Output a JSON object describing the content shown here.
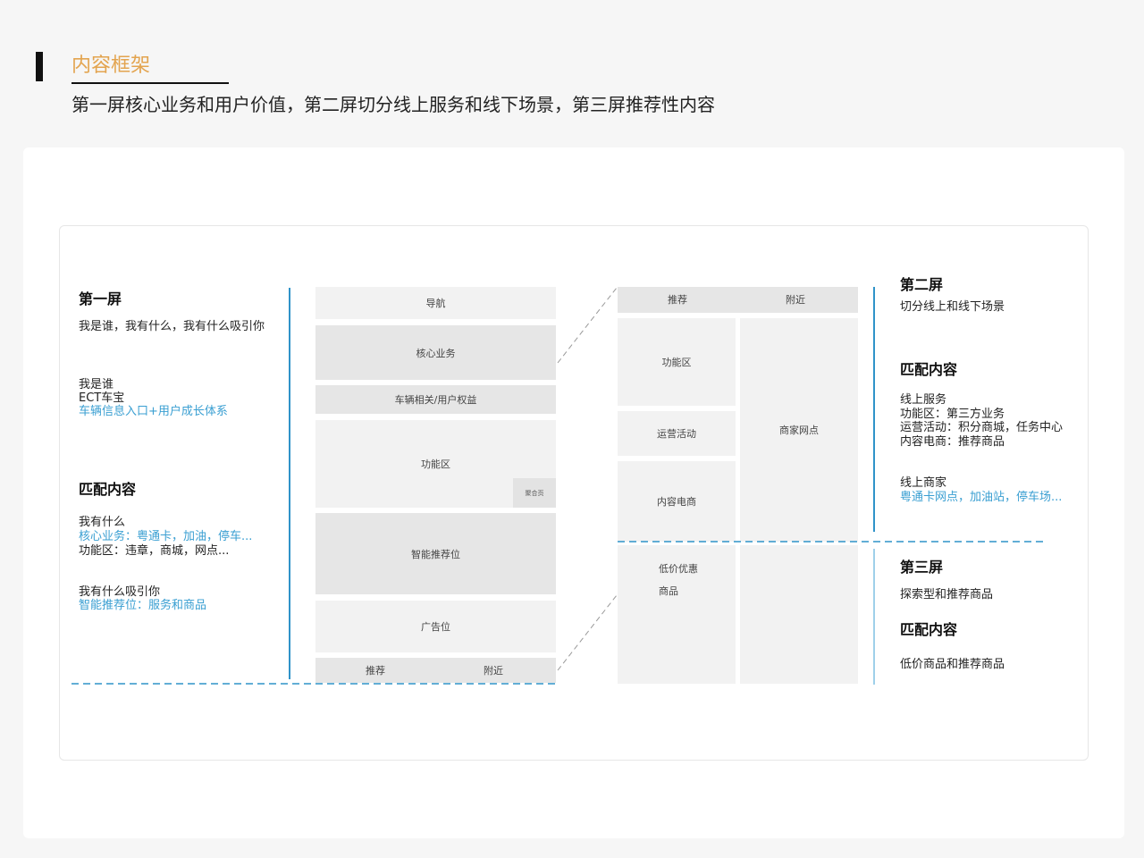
{
  "header": {
    "title": "内容框架",
    "subtitle": "第一屏核心业务和用户价值，第二屏切分线上服务和线下场景，第三屏推荐性内容"
  },
  "left_panel": {
    "screen_title": "第一屏",
    "screen_desc": "我是谁，我有什么，我有什么吸引你",
    "who_label": "我是谁",
    "who_name": "ECT车宝",
    "who_detail": "车辆信息入口+用户成长体系",
    "match_title": "匹配内容",
    "what_label": "我有什么",
    "what_core": "核心业务：粤通卡，加油，停车...",
    "what_func": "功能区：违章，商城，网点...",
    "attract_label": "我有什么吸引你",
    "attract_detail": "智能推荐位：服务和商品"
  },
  "wireframe_screen1": {
    "nav": "导航",
    "core": "核心业务",
    "vehicle": "车辆相关/用户权益",
    "function": "功能区",
    "aggregate": "聚合页",
    "smart": "智能推荐位",
    "ad": "广告位",
    "tab_recommend": "推荐",
    "tab_nearby": "附近"
  },
  "wireframe_screen2": {
    "tab_recommend": "推荐",
    "tab_nearby": "附近",
    "function": "功能区",
    "operation": "运营活动",
    "ecommerce": "内容电商",
    "merchant": "商家网点",
    "discount": "低价优惠",
    "goods": "商品"
  },
  "right_panel": {
    "screen2_title": "第二屏",
    "screen2_desc": "切分线上和线下场景",
    "match_title": "匹配内容",
    "online_service": "线上服务",
    "func_area": "功能区：第三方业务",
    "operation": "运营活动：积分商城，任务中心",
    "ecommerce": "内容电商：推荐商品",
    "online_merchant": "线上商家",
    "merchant_detail": "粤通卡网点，加油站，停车场...",
    "screen3_title": "第三屏",
    "screen3_desc": "探索型和推荐商品",
    "match_title2": "匹配内容",
    "screen3_detail": "低价商品和推荐商品"
  },
  "colors": {
    "accent_title": "#e3a44f",
    "blue_text": "#3a9fd2",
    "divider_blue": "#2f93c9"
  }
}
